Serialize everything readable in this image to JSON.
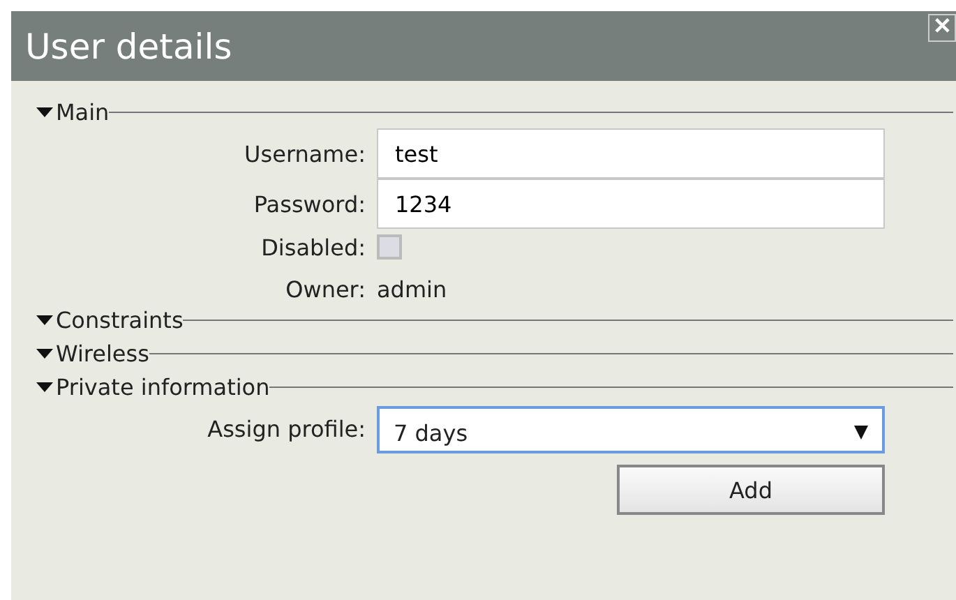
{
  "window": {
    "title": "User details",
    "close": "✕"
  },
  "sections": [
    {
      "title": "Main",
      "expanded": true,
      "fields": [
        {
          "kind": "text",
          "label": "Username:",
          "value": "test"
        },
        {
          "kind": "text",
          "label": "Password:",
          "value": "1234"
        },
        {
          "kind": "checkbox",
          "label": "Disabled:",
          "checked": false
        },
        {
          "kind": "static",
          "label": "Owner:",
          "value": "admin"
        }
      ]
    },
    {
      "title": "Constraints",
      "expanded": true
    },
    {
      "title": "Wireless",
      "expanded": true
    },
    {
      "title": "Private information",
      "expanded": true,
      "fields": [
        {
          "kind": "select",
          "label": "Assign profile:",
          "value": "7 days"
        },
        {
          "kind": "button",
          "label": "Add"
        }
      ]
    }
  ]
}
